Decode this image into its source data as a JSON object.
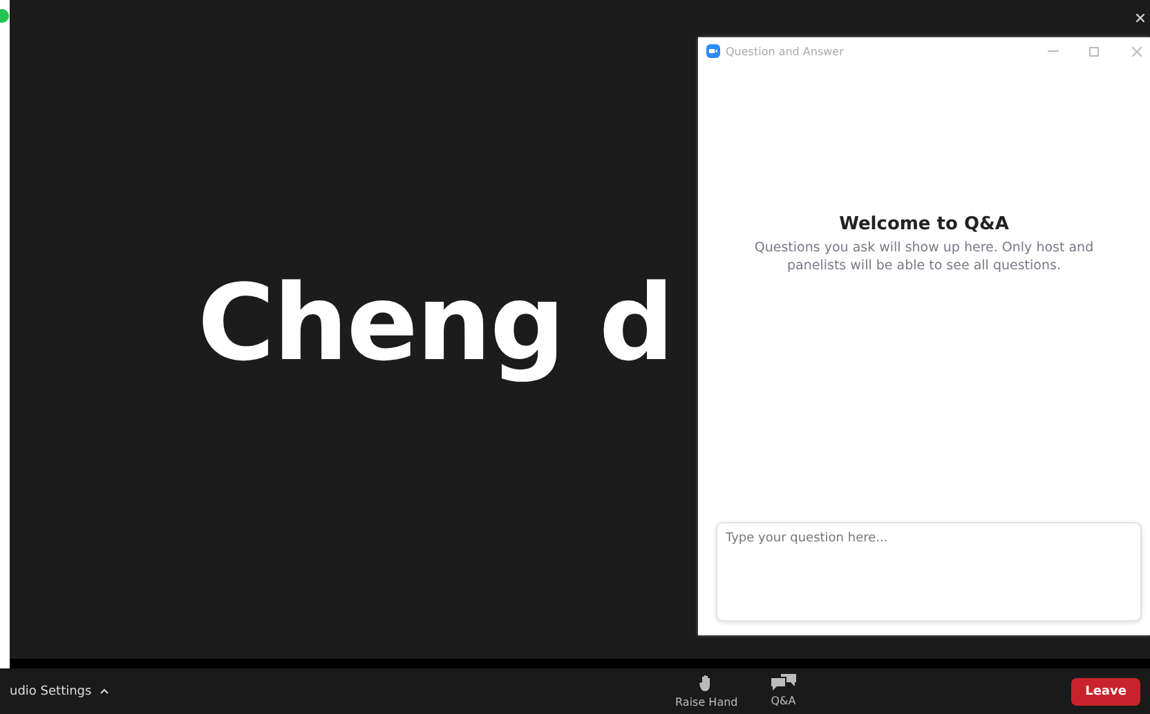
{
  "video": {
    "name": "Cheng d"
  },
  "qa_window": {
    "title": "Question and Answer",
    "heading": "Welcome to Q&A",
    "message": "Questions you ask will show up here. Only host and panelists will be able to see all questions.",
    "input": {
      "placeholder": "Type your question here..."
    }
  },
  "toolbar": {
    "audio_settings": "udio Settings",
    "actions": [
      {
        "kind": "hand",
        "label": "Raise Hand"
      },
      {
        "kind": "chat",
        "label": "Q&A"
      }
    ],
    "leave": "Leave"
  }
}
